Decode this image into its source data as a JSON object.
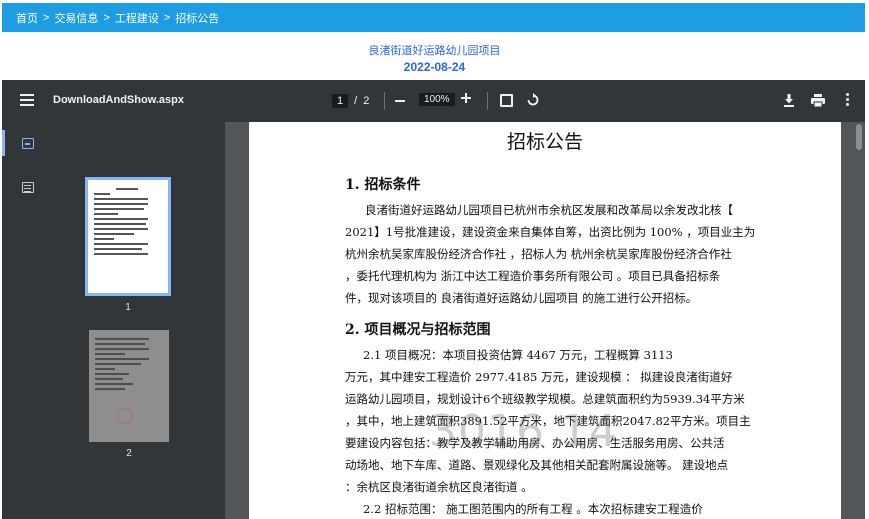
{
  "breadcrumb": [
    "首页",
    "交易信息",
    "工程建设",
    "招标公告"
  ],
  "breadcrumb_separator": ">",
  "header": {
    "project_title": "良渚街道好运路幼儿园项目",
    "date": "2022-08-24"
  },
  "toolbar": {
    "file_name": "DownloadAndShow.aspx",
    "current_page": "1",
    "page_sep": "/",
    "total_pages": "2",
    "zoom": "100%"
  },
  "sidebar": {
    "thumb1_label": "1",
    "thumb2_label": "2"
  },
  "document": {
    "title": "招标公告",
    "section1_heading": "1.   招标条件",
    "section1_lines": [
      "良渚街道好运路幼儿园项目已杭州市余杭区发展和改革局以余发改北核【",
      "2021】1号批准建设，建设资金来自集体自筹，出资比例为 100% ，项目业主为",
      "杭州余杭吴家库股份经济合作社  ，招标人为 杭州余杭吴家库股份经济合作社",
      "，委托代理机构为    浙江中达工程造价事务所有限公司  。项目已具备招标条",
      "件，现对该项目的    良渚街道好运路幼儿园项目  的施工进行公开招标。"
    ],
    "section2_heading": "2.   项目概况与招标范围",
    "section2_lines": [
      "2.1    项目概况：本项目投资估算   4467   万元，工程概算 3113",
      "万元，其中建安工程造价  2977.4185   万元，建设规模 ：  拟建设良渚街道好",
      "运路幼儿园项目，规划设计6个班级教学规模。总建筑面积约为5939.34平方米",
      "，其中，地上建筑面积3891.52平方米，地下建筑面积2047.82平方米。项目主",
      "要建设内容包括：教学及教学辅助用房、办公用房、生活服务用房、公共活",
      "动场地、地下车库、道路、景观绿化及其他相关配套附属设施等。  建设地点",
      "：余杭区良渚街道余杭区良渚街道  。",
      "2.2    招标范围：    施工图范围内的所有工程    。本次招标建安工程造价"
    ],
    "watermark": "3016 14"
  },
  "icons": {
    "menu": "hamburger-menu-icon",
    "fit": "fit-to-page-icon",
    "rotate": "rotate-icon",
    "download": "download-icon",
    "print": "print-icon",
    "more": "more-vert-icon",
    "thumbnails": "thumbnails-icon",
    "outline": "document-outline-icon"
  },
  "colors": {
    "breadcrumb_bg": "#1f9de3",
    "title_text": "#2d64d8",
    "toolbar_bg": "#323639",
    "viewer_bg": "#525659",
    "accent": "#8ab4f8"
  }
}
